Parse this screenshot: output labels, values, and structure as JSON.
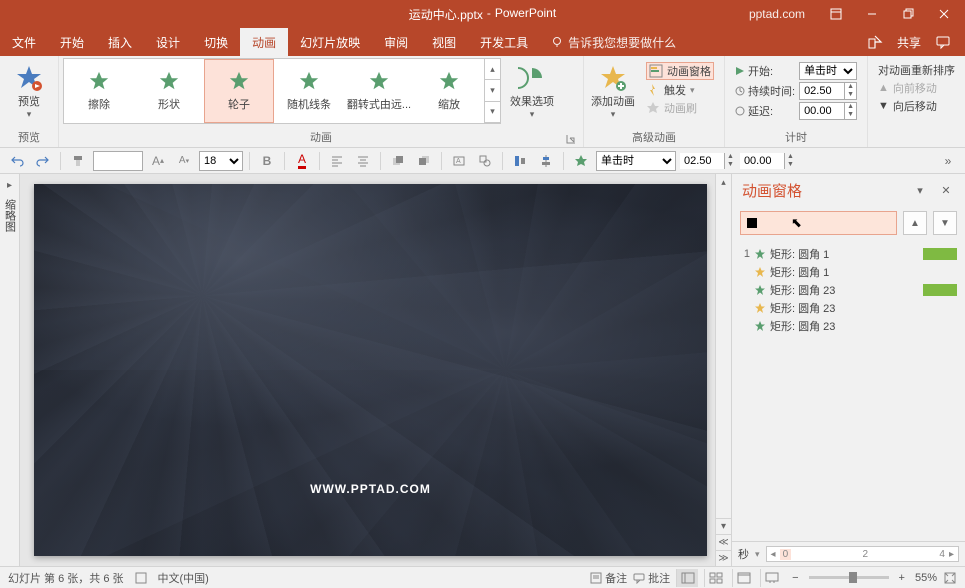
{
  "titlebar": {
    "filename": "运动中心.pptx",
    "app": "PowerPoint",
    "link": "pptad.com"
  },
  "menubar": {
    "tabs": [
      "文件",
      "开始",
      "插入",
      "设计",
      "切换",
      "动画",
      "幻灯片放映",
      "审阅",
      "视图",
      "开发工具"
    ],
    "active_index": 5,
    "tell_me": "告诉我您想要做什么",
    "share": "共享"
  },
  "ribbon": {
    "preview": {
      "label": "预览",
      "group": "预览"
    },
    "gallery": {
      "items": [
        {
          "label": "擦除",
          "color": "green"
        },
        {
          "label": "形状",
          "color": "green"
        },
        {
          "label": "轮子",
          "color": "green",
          "selected": true
        },
        {
          "label": "随机线条",
          "color": "green"
        },
        {
          "label": "翻转式由远...",
          "color": "green"
        },
        {
          "label": "缩放",
          "color": "green"
        }
      ],
      "group": "动画"
    },
    "effect_options": {
      "label": "效果选项"
    },
    "add_anim": {
      "label": "添加动画",
      "group": "高级动画"
    },
    "adv": {
      "pane": "动画窗格",
      "trigger": "触发",
      "painter": "动画刷"
    },
    "timing": {
      "start_lbl": "开始:",
      "start_val": "单击时",
      "duration_lbl": "持续时间:",
      "duration_val": "02.50",
      "delay_lbl": "延迟:",
      "delay_val": "00.00",
      "group": "计时"
    },
    "reorder": {
      "hdr": "对动画重新排序",
      "earlier": "向前移动",
      "later": "向后移动"
    }
  },
  "qat": {
    "font_size": "18",
    "start": "单击时",
    "duration": "02.50",
    "delay": "00.00"
  },
  "slide": {
    "watermark": "WWW.PPTAD.COM"
  },
  "thumbnails_label": "缩略图",
  "anim_pane": {
    "title": "动画窗格",
    "items": [
      {
        "num": "1",
        "star": "green",
        "name": "矩形: 圆角 1",
        "bar": true
      },
      {
        "num": "",
        "star": "yellow",
        "name": "矩形: 圆角 1",
        "bar": false
      },
      {
        "num": "",
        "star": "green",
        "name": "矩形: 圆角 23",
        "bar": true
      },
      {
        "num": "",
        "star": "yellow",
        "name": "矩形: 圆角 23",
        "bar": false
      },
      {
        "num": "",
        "star": "green",
        "name": "矩形: 圆角 23",
        "bar": false
      }
    ],
    "seconds": "秒",
    "timeline": [
      "0",
      "2",
      "4"
    ]
  },
  "statusbar": {
    "slide_info": "幻灯片 第 6 张，共 6 张",
    "lang": "中文(中国)",
    "notes": "备注",
    "comments": "批注",
    "zoom": "55%"
  }
}
